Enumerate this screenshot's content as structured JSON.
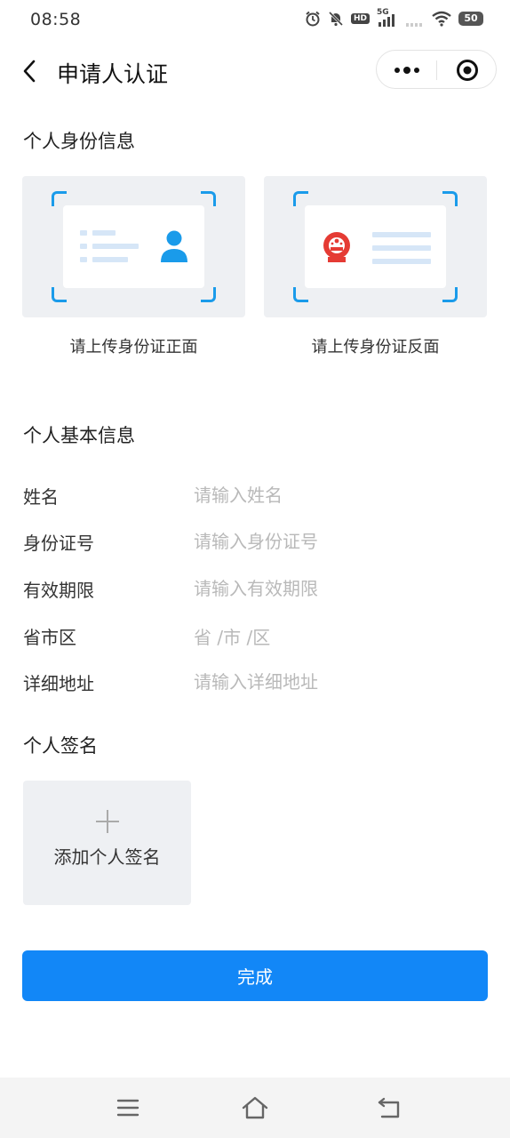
{
  "status_bar": {
    "time": "08:58",
    "network": "5G",
    "hd_label": "HD",
    "battery": "50"
  },
  "nav": {
    "title": "申请人认证"
  },
  "identity_section": {
    "title": "个人身份信息",
    "front_caption": "请上传身份证正面",
    "back_caption": "请上传身份证反面"
  },
  "basic_section": {
    "title": "个人基本信息",
    "fields": [
      {
        "label": "姓名",
        "placeholder": "请输入姓名"
      },
      {
        "label": "身份证号",
        "placeholder": "请输入身份证号"
      },
      {
        "label": "有效期限",
        "placeholder": "请输入有效期限"
      },
      {
        "label": "省市区",
        "placeholder": "省 /市 /区"
      },
      {
        "label": "详细地址",
        "placeholder": "请输入详细地址"
      }
    ]
  },
  "signature_section": {
    "title": "个人签名",
    "add_label": "添加个人签名"
  },
  "submit_label": "完成",
  "colors": {
    "primary": "#1287f7",
    "accent_blue": "#1a9bea",
    "emblem_red": "#e53b34",
    "card_bg": "#eef0f3"
  }
}
